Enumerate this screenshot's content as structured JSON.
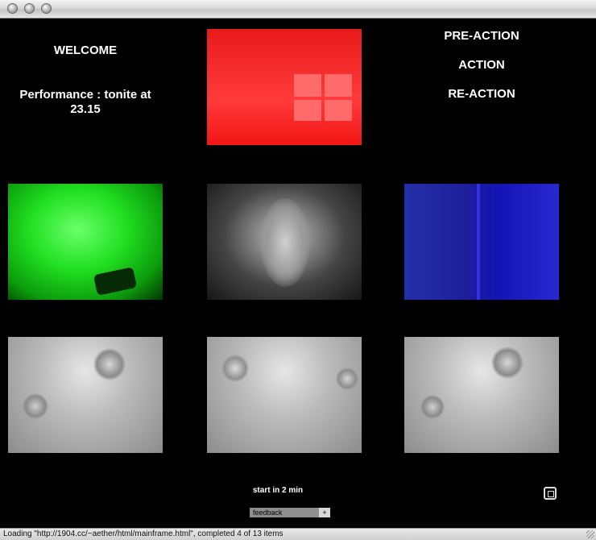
{
  "window": {
    "buttons": [
      "close",
      "minimize",
      "zoom"
    ]
  },
  "left": {
    "welcome": "WELCOME",
    "performance": "Performance : tonite at 23.15"
  },
  "right": {
    "menu": [
      "PRE-ACTION",
      "ACTION",
      "RE-ACTION"
    ]
  },
  "feeds": {
    "row1": [
      "red-room-window-feed"
    ],
    "row2": [
      "green-room-bed-feed",
      "face-portrait-feed",
      "blue-room-door-feed"
    ],
    "row3": [
      "gray-closeup-feed-1",
      "gray-closeup-feed-2",
      "gray-closeup-feed-3"
    ]
  },
  "bottom": {
    "start_text": "start in 2 min",
    "feedback_label": "feedback",
    "plus_label": "+"
  },
  "status": {
    "text": "Loading \"http://1904.cc/~aether/html/mainframe.html\", completed 4 of 13 items"
  },
  "colors": {
    "background": "#000000",
    "text": "#ffffff",
    "red_feed": "#ff2a2a",
    "green_feed": "#21e021",
    "blue_feed": "#1e1eb0"
  }
}
